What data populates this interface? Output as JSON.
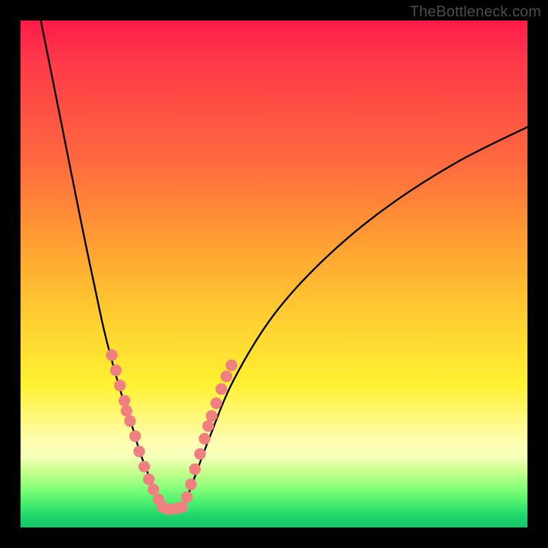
{
  "attribution": "TheBottleneck.com",
  "colors": {
    "curve": "#000000",
    "dot_fill": "#f08080",
    "dot_stroke": "#cc5b5b",
    "gradient_top": "#ff1a4a",
    "gradient_bottom": "#18c566",
    "frame": "#000000"
  },
  "chart_data": {
    "type": "line",
    "title": "",
    "xlabel": "",
    "ylabel": "",
    "xlim": [
      0,
      100
    ],
    "ylim": [
      0,
      100
    ],
    "note": "Two black curves descending from top edges, meeting near (28, 5) with a short flat bottom; salmon-colored dots cluster on both arms near the trough.",
    "series": [
      {
        "name": "left-arm",
        "x": [
          4,
          8,
          12,
          16,
          18,
          20,
          22,
          23.5,
          25,
          26.5,
          28
        ],
        "y": [
          100,
          80,
          60,
          41,
          33,
          26,
          20,
          15,
          11,
          7,
          4
        ]
      },
      {
        "name": "bottom-flat",
        "x": [
          28,
          30,
          32
        ],
        "y": [
          4,
          3.5,
          4
        ]
      },
      {
        "name": "right-arm",
        "x": [
          32,
          34,
          37,
          42,
          50,
          60,
          72,
          86,
          100
        ],
        "y": [
          4,
          9,
          17,
          29,
          42,
          53,
          63,
          72,
          79
        ]
      }
    ],
    "dots": [
      {
        "x": 18.0,
        "y": 34
      },
      {
        "x": 18.8,
        "y": 31
      },
      {
        "x": 19.6,
        "y": 28
      },
      {
        "x": 20.5,
        "y": 25
      },
      {
        "x": 20.9,
        "y": 23
      },
      {
        "x": 21.6,
        "y": 21
      },
      {
        "x": 22.6,
        "y": 18
      },
      {
        "x": 23.4,
        "y": 15
      },
      {
        "x": 24.4,
        "y": 12
      },
      {
        "x": 25.3,
        "y": 9.5
      },
      {
        "x": 26.2,
        "y": 7.5
      },
      {
        "x": 27.2,
        "y": 5.5
      },
      {
        "x": 28.0,
        "y": 4.0
      },
      {
        "x": 29.2,
        "y": 3.6
      },
      {
        "x": 30.6,
        "y": 3.7
      },
      {
        "x": 31.8,
        "y": 4.0
      },
      {
        "x": 32.8,
        "y": 6.0
      },
      {
        "x": 33.6,
        "y": 8.5
      },
      {
        "x": 34.4,
        "y": 11.5
      },
      {
        "x": 35.4,
        "y": 14.5
      },
      {
        "x": 36.3,
        "y": 17.5
      },
      {
        "x": 37.0,
        "y": 20.0
      },
      {
        "x": 37.7,
        "y": 22.0
      },
      {
        "x": 38.6,
        "y": 24.5
      },
      {
        "x": 39.6,
        "y": 27.3
      },
      {
        "x": 40.6,
        "y": 29.8
      },
      {
        "x": 41.6,
        "y": 32.0
      }
    ]
  }
}
